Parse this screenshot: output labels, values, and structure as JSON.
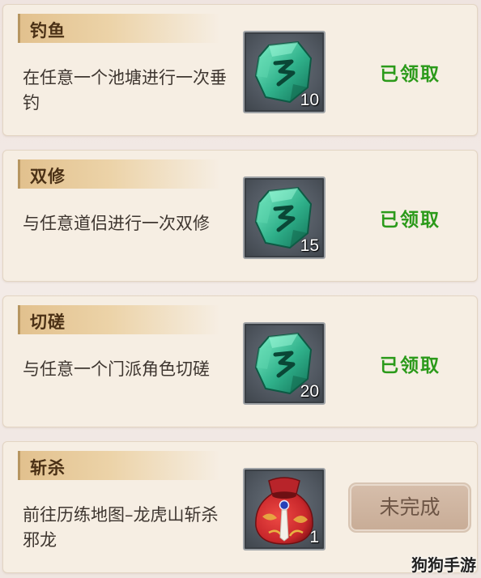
{
  "tasks": [
    {
      "title": "钓鱼",
      "description": "在任意一个池塘进行一次垂钓",
      "reward_icon": "jade-stone-icon",
      "reward_count": "10",
      "status": "已领取",
      "status_type": "claimed"
    },
    {
      "title": "双修",
      "description": "与任意道侣进行一次双修",
      "reward_icon": "jade-stone-icon",
      "reward_count": "15",
      "status": "已领取",
      "status_type": "claimed"
    },
    {
      "title": "切磋",
      "description": "与任意一个门派角色切磋",
      "reward_icon": "jade-stone-icon",
      "reward_count": "20",
      "status": "已领取",
      "status_type": "claimed"
    },
    {
      "title": "斩杀",
      "description": "前往历练地图–龙虎山斩杀邪龙",
      "reward_icon": "red-pouch-icon",
      "reward_count": "1",
      "status": "未完成",
      "status_type": "incomplete"
    }
  ],
  "watermark": "狗狗手游",
  "colors": {
    "claimed": "#2b9a1a",
    "jade": "#2fb08a",
    "pouch": "#c8272b"
  }
}
